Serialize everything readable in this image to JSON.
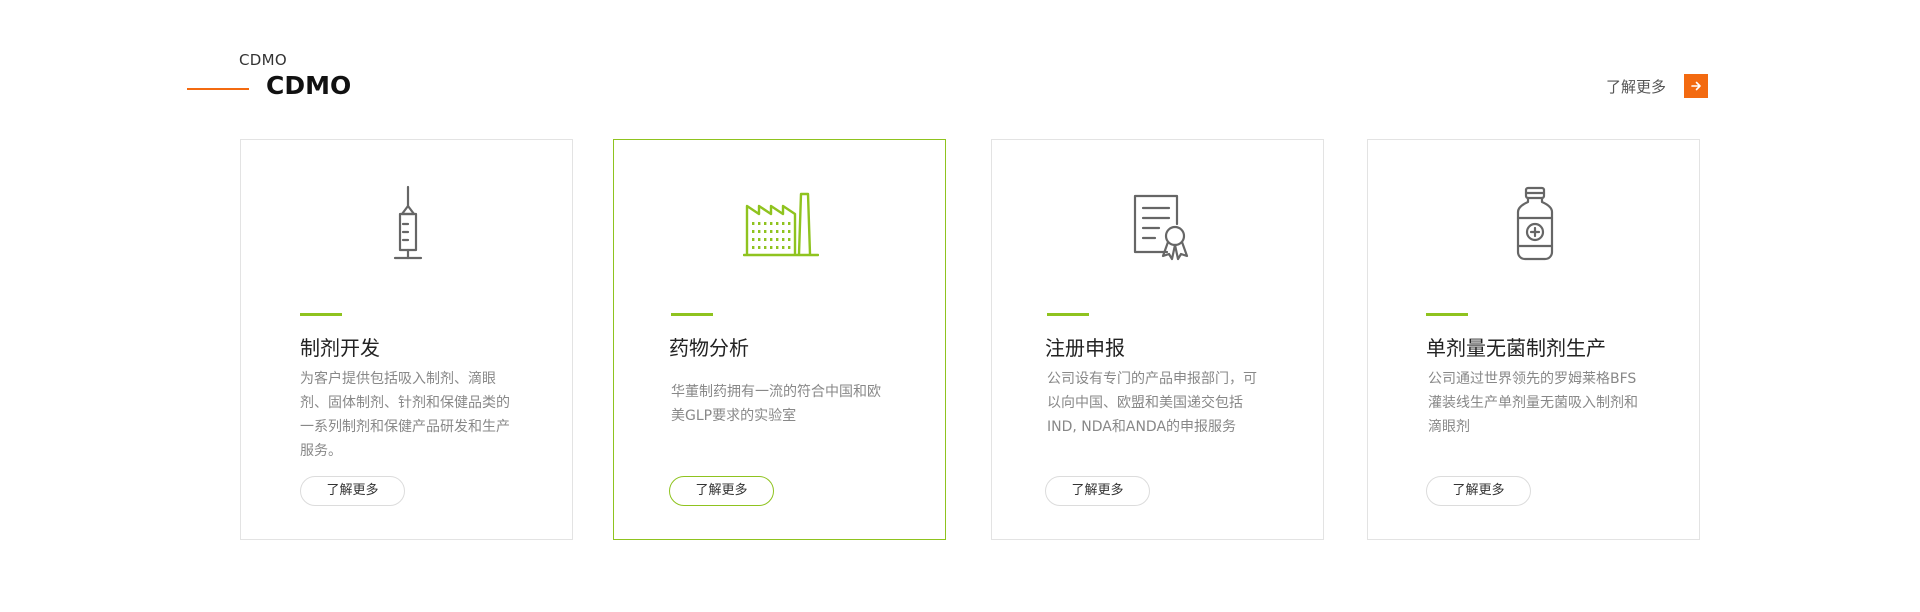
{
  "section": {
    "eyebrow": "CDMO",
    "title": "CDMO",
    "more_label": "了解更多"
  },
  "colors": {
    "accent_orange": "#f36a10",
    "accent_green": "#8fc31f",
    "icon_gray": "#666666",
    "border_gray": "#e3e3e3"
  },
  "cards": [
    {
      "icon": "syringe-icon",
      "title": "制剂开发",
      "description": "为客户提供包括吸入制剂、滴眼剂、固体制剂、针剂和保健品类的一系列制剂和保健产品研发和生产服务。",
      "button": "了解更多",
      "active": false
    },
    {
      "icon": "factory-icon",
      "title": "药物分析",
      "description": "华董制药拥有一流的符合中国和欧美GLP要求的实验室",
      "button": "了解更多",
      "active": true
    },
    {
      "icon": "certificate-icon",
      "title": "注册申报",
      "description": "公司设有专门的产品申报部门，可以向中国、欧盟和美国递交包括IND, NDA和ANDA的申报服务",
      "button": "了解更多",
      "active": false
    },
    {
      "icon": "medicine-bottle-icon",
      "title": "单剂量无菌制剂生产",
      "description": "公司通过世界领先的罗姆莱格BFS灌装线生产单剂量无菌吸入制剂和滴眼剂",
      "button": "了解更多",
      "active": false
    }
  ]
}
